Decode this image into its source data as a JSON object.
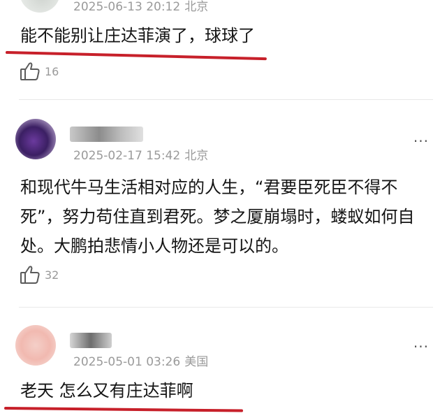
{
  "comments": [
    {
      "time": "2025-06-13 20:12",
      "location": "北京",
      "text": "能不能别让庄达菲演了，球球了",
      "likes": "16"
    },
    {
      "time": "2025-02-17 15:42",
      "location": "北京",
      "text": "和现代牛马生活相对应的人生，“君要臣死臣不得不死”，努力苟住直到君死。梦之厦崩塌时，蝼蚁如何自处。大鹏拍悲情小人物还是可以的。",
      "likes": "32"
    },
    {
      "time": "2025-05-01 03:26",
      "location": "美国",
      "text": "老天 怎么又有庄达菲啊"
    }
  ],
  "more_label": "···",
  "colors": {
    "underline": "#c7202a",
    "meta": "#9a9a9a"
  }
}
